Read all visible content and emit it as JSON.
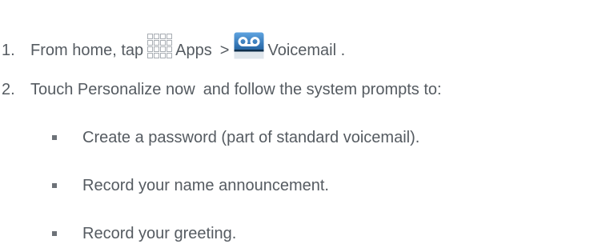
{
  "steps": [
    {
      "number": "1.",
      "text_before": "From home, tap",
      "apps_icon": "apps-grid-icon",
      "apps_label": "Apps",
      "separator": ">",
      "voicemail_icon": "voicemail-icon",
      "voicemail_label": "Voicemail",
      "end": "."
    },
    {
      "number": "2.",
      "text_before": "Touch Personalize now",
      "text_after": "and follow the system prompts to:"
    }
  ],
  "bullets": [
    "Create a password (part of standard voicemail).",
    "Record your name announcement.",
    "Record your greeting."
  ],
  "colors": {
    "text": "#555b61",
    "bullet": "#6d7278",
    "apps_icon_stroke": "#a8adb3",
    "voicemail_icon_top": "#5ea3e0",
    "voicemail_icon_bottom": "#18466f"
  }
}
